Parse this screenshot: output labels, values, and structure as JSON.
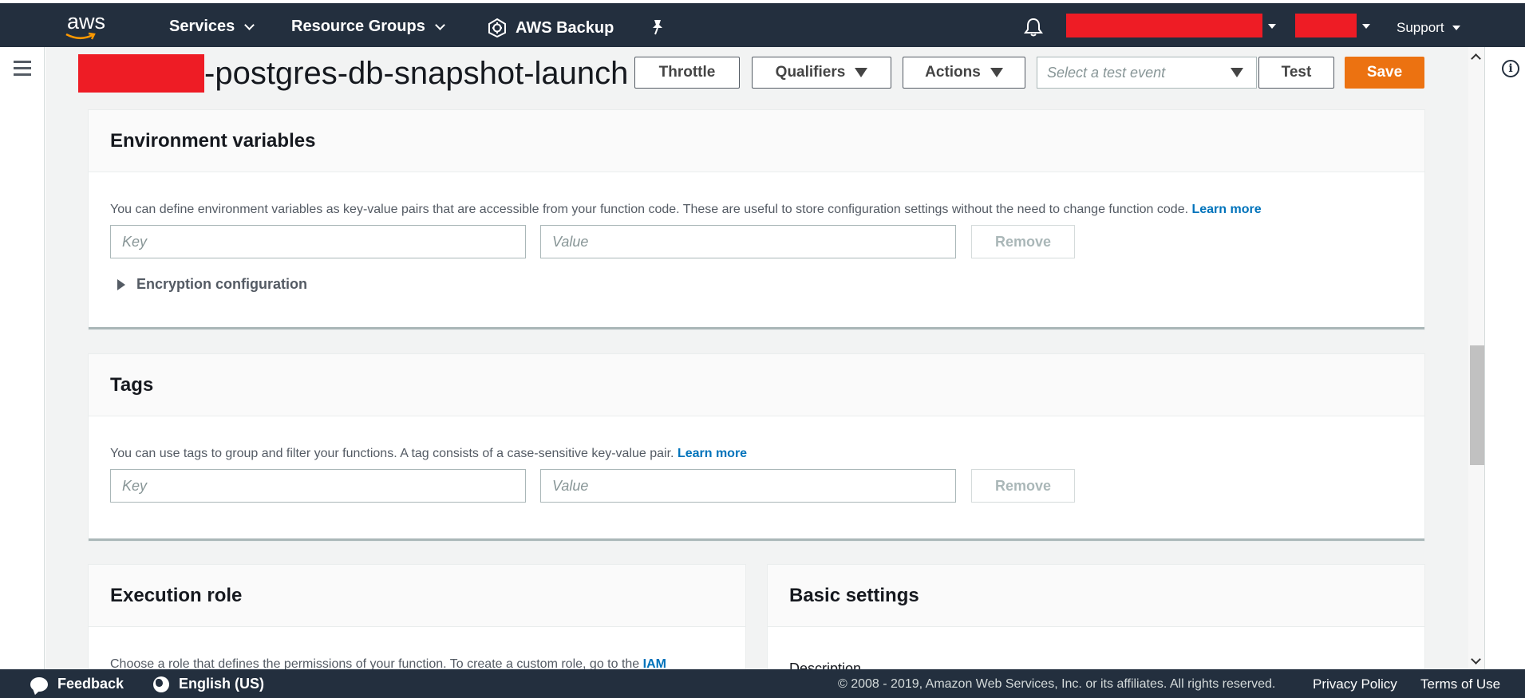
{
  "topnav": {
    "logo_text": "aws",
    "services_label": "Services",
    "resource_groups_label": "Resource Groups",
    "backup_label": "AWS Backup",
    "support_label": "Support"
  },
  "header": {
    "function_title": "-postgres-db-snapshot-launch",
    "throttle_label": "Throttle",
    "qualifiers_label": "Qualifiers",
    "actions_label": "Actions",
    "test_event_placeholder": "Select a test event",
    "test_label": "Test",
    "save_label": "Save"
  },
  "env_vars": {
    "title": "Environment variables",
    "description": "You can define environment variables as key-value pairs that are accessible from your function code. These are useful to store configuration settings without the need to change function code.",
    "learn_more": "Learn more",
    "key_placeholder": "Key",
    "value_placeholder": "Value",
    "remove_label": "Remove",
    "encryption_label": "Encryption configuration"
  },
  "tags": {
    "title": "Tags",
    "description": "You can use tags to group and filter your functions. A tag consists of a case-sensitive key-value pair.",
    "learn_more": "Learn more",
    "key_placeholder": "Key",
    "value_placeholder": "Value",
    "remove_label": "Remove"
  },
  "execution_role": {
    "title": "Execution role",
    "description": "Choose a role that defines the permissions of your function. To create a custom role, go to the",
    "link": "IAM"
  },
  "basic_settings": {
    "title": "Basic settings",
    "description_label": "Description"
  },
  "footer": {
    "feedback_label": "Feedback",
    "language_label": "English (US)",
    "copyright": "© 2008 - 2019, Amazon Web Services, Inc. or its affiliates. All rights reserved.",
    "privacy_label": "Privacy Policy",
    "terms_label": "Terms of Use"
  },
  "colors": {
    "nav_bg": "#232f3e",
    "accent_orange": "#ec7211",
    "link_blue": "#0073bb",
    "redaction": "#ee1c25"
  }
}
